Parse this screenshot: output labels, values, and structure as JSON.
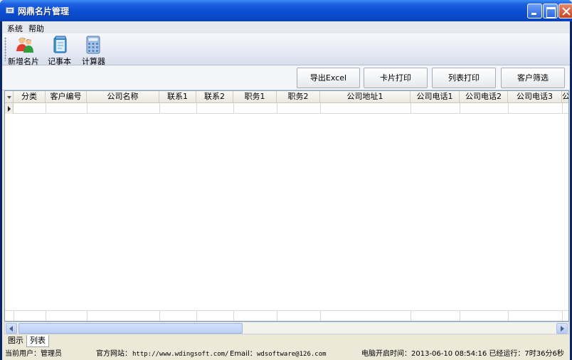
{
  "window": {
    "title": "网鼎名片管理"
  },
  "menu": [
    {
      "label": "系统"
    },
    {
      "label": "帮助"
    }
  ],
  "toolbar": [
    {
      "label": "新增名片",
      "icon": "users-icon"
    },
    {
      "label": "记事本",
      "icon": "notepad-icon"
    },
    {
      "label": "计算器",
      "icon": "calculator-icon"
    }
  ],
  "actions": [
    {
      "label": "导出Excel"
    },
    {
      "label": "卡片打印"
    },
    {
      "label": "列表打印"
    },
    {
      "label": "客户筛选"
    }
  ],
  "grid": {
    "columns": [
      "分类",
      "客户编号",
      "公司名称",
      "联系1",
      "联系2",
      "职务1",
      "职务2",
      "公司地址1",
      "公司电话1",
      "公司电话2",
      "公司电话3",
      "公"
    ]
  },
  "tabs": [
    {
      "label": "图示"
    },
    {
      "label": "列表",
      "active": true
    }
  ],
  "status": {
    "user": "当前用户：管理员",
    "website_label": "官方网站：",
    "website": "http://www.wdingsoft.com/",
    "email_label": "Email：",
    "email": "wdsoftware@126.com",
    "boot": "电脑开启时间：2013-06-10 08:54:16 已经运行：7时36分6秒"
  },
  "colors": {
    "title_bar": "#0A4ED3",
    "window_bg": "#ECE9D8",
    "grid_border": "#7F9DB9"
  }
}
